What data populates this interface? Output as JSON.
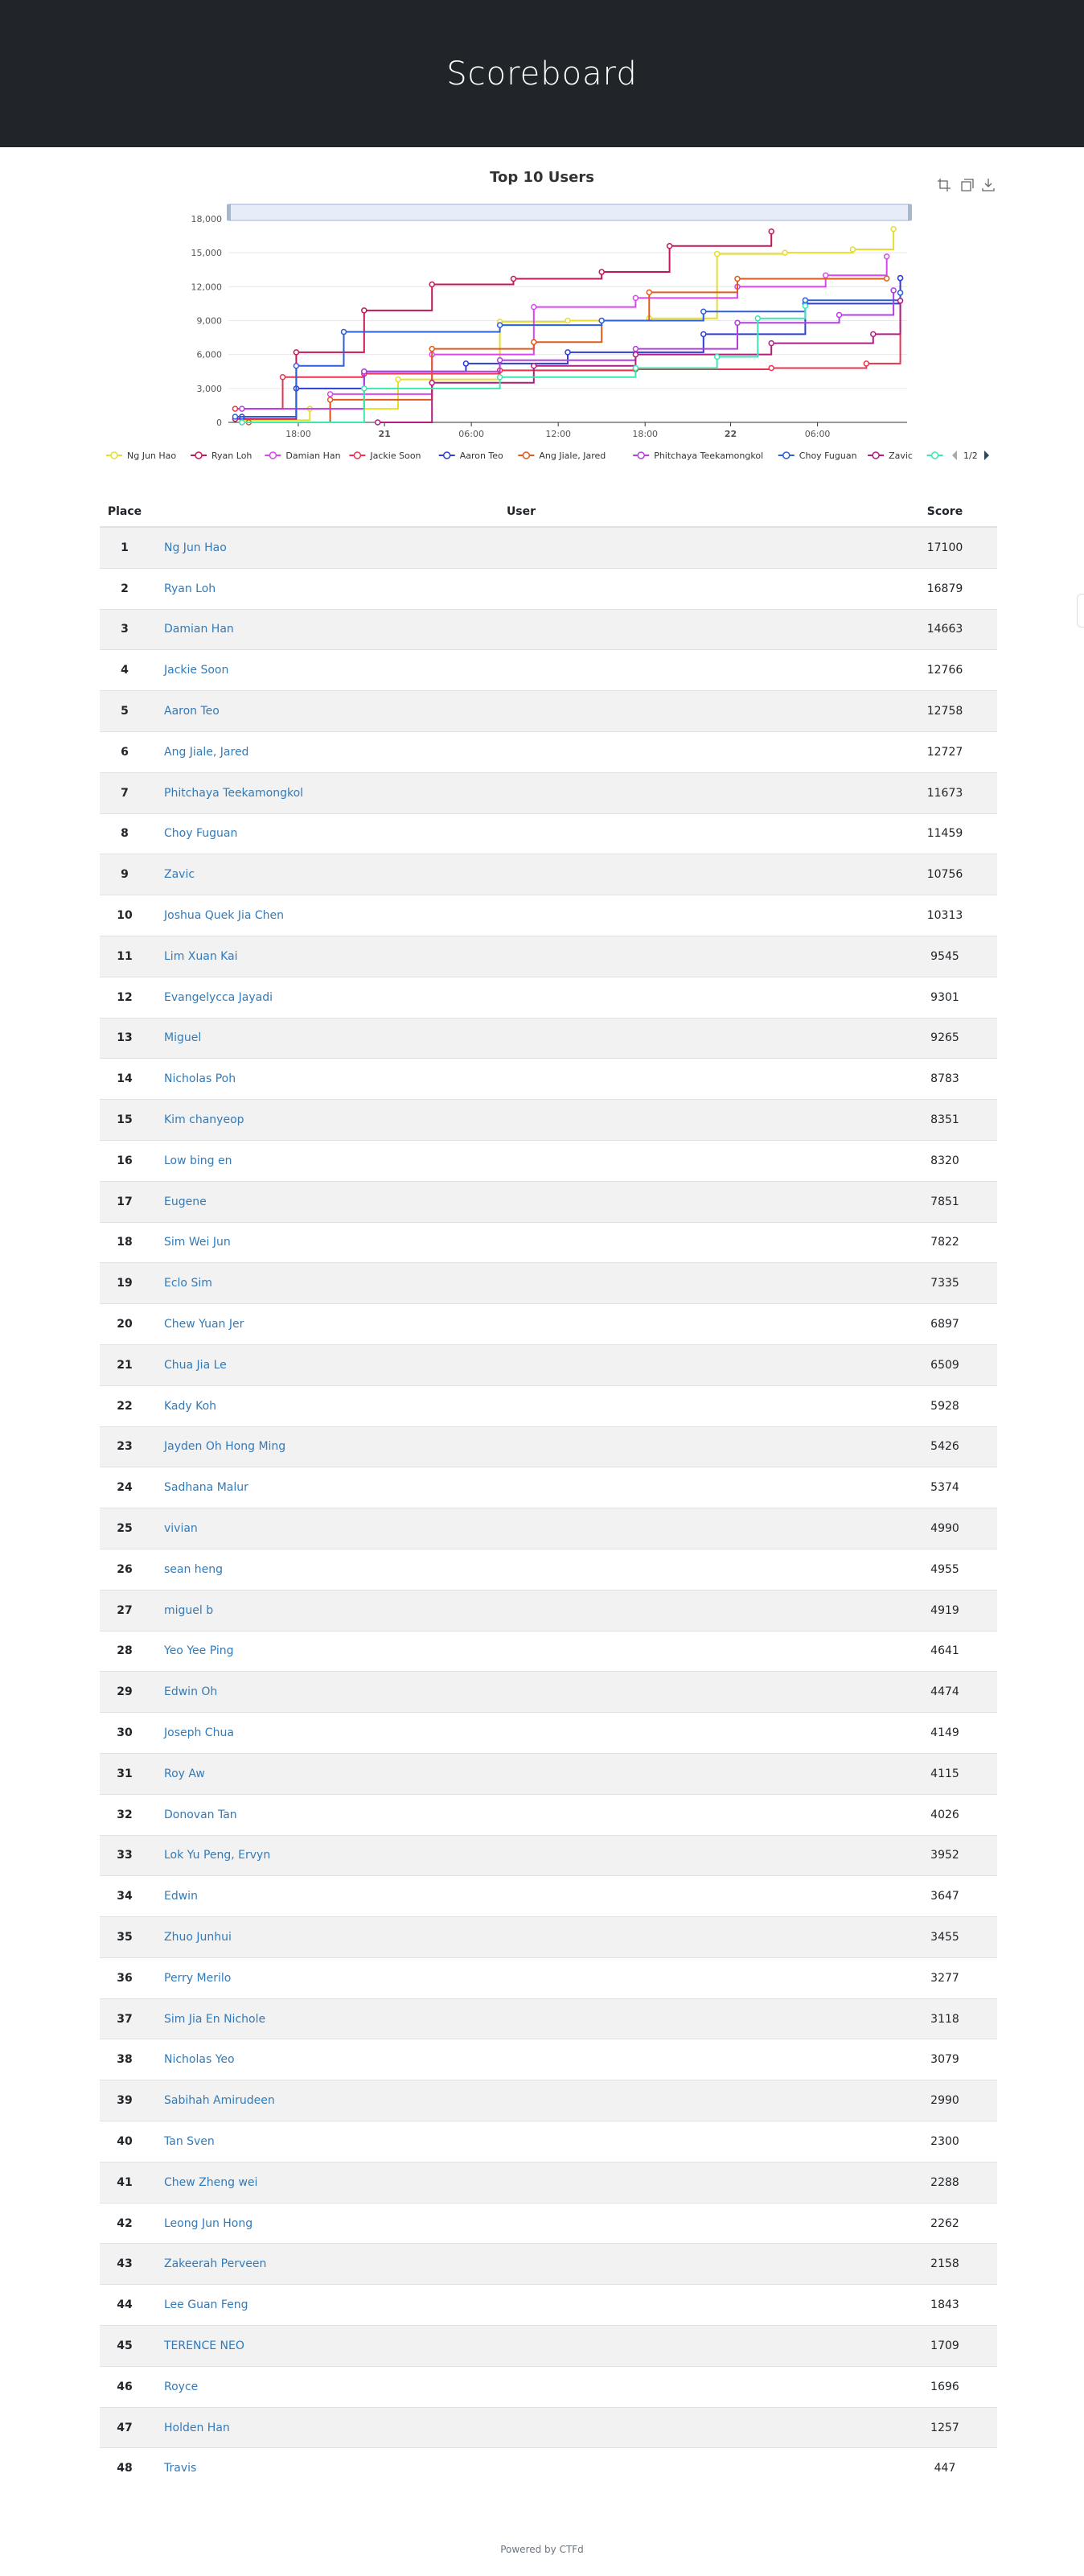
{
  "page": {
    "title": "Scoreboard"
  },
  "chart": {
    "title": "Top 10 Users",
    "y_ticks": [
      "0",
      "3,000",
      "6,000",
      "9,000",
      "12,000",
      "15,000",
      "18,000"
    ],
    "x_ticks": [
      "18:00",
      "21",
      "06:00",
      "12:00",
      "18:00",
      "22",
      "06:00"
    ],
    "legend": [
      {
        "name": "Ng Jun Hao",
        "color": "#e6dd2f"
      },
      {
        "name": "Ryan Loh",
        "color": "#c2185b"
      },
      {
        "name": "Damian Han",
        "color": "#d946ef"
      },
      {
        "name": "Jackie Soon",
        "color": "#e8344e"
      },
      {
        "name": "Aaron Teo",
        "color": "#2c3fd6"
      },
      {
        "name": "Ang Jiale, Jared",
        "color": "#e05a1b"
      },
      {
        "name": "Phitchaya Teekamongkol",
        "color": "#b43fe0"
      },
      {
        "name": "Choy Fuguan",
        "color": "#2f5fd6"
      },
      {
        "name": "Zavic",
        "color": "#b01e80"
      },
      {
        "name": "",
        "color": "#3ee6b0"
      }
    ],
    "legend_page": "1/2",
    "toolbox_icons": [
      "zoom-icon",
      "zoom-reset-icon",
      "download-icon"
    ]
  },
  "chart_data": {
    "type": "line",
    "title": "Top 10 Users",
    "ylim": [
      0,
      18000
    ],
    "x_axis": "time",
    "x_ticks": [
      "18:00",
      "21",
      "06:00",
      "12:00",
      "18:00",
      "22",
      "06:00"
    ],
    "series": [
      {
        "name": "Ng Jun Hao",
        "x": [
          0.02,
          0.12,
          0.25,
          0.4,
          0.5,
          0.62,
          0.72,
          0.82,
          0.92,
          0.98
        ],
        "values": [
          200,
          1200,
          3800,
          8900,
          9000,
          9200,
          14900,
          15000,
          15300,
          17100
        ]
      },
      {
        "name": "Ryan Loh",
        "x": [
          0.01,
          0.1,
          0.2,
          0.3,
          0.42,
          0.55,
          0.65,
          0.8
        ],
        "values": [
          300,
          6200,
          9900,
          12200,
          12700,
          13300,
          15600,
          16879
        ]
      },
      {
        "name": "Damian Han",
        "x": [
          0.02,
          0.15,
          0.3,
          0.45,
          0.6,
          0.75,
          0.88,
          0.97
        ],
        "values": [
          0,
          2500,
          6000,
          10200,
          11000,
          12000,
          13000,
          14663
        ]
      },
      {
        "name": "Jackie Soon",
        "x": [
          0.01,
          0.08,
          0.2,
          0.4,
          0.6,
          0.8,
          0.94,
          0.99
        ],
        "values": [
          1200,
          4000,
          4300,
          4600,
          4700,
          4800,
          5200,
          12766
        ]
      },
      {
        "name": "Aaron Teo",
        "x": [
          0.02,
          0.1,
          0.2,
          0.35,
          0.5,
          0.7,
          0.85,
          0.99
        ],
        "values": [
          500,
          3000,
          4500,
          5200,
          6200,
          7800,
          10500,
          12758
        ]
      },
      {
        "name": "Ang Jiale, Jared",
        "x": [
          0.03,
          0.15,
          0.3,
          0.45,
          0.55,
          0.62,
          0.75,
          0.97
        ],
        "values": [
          0,
          2000,
          6500,
          7100,
          9000,
          11500,
          12700,
          12727
        ]
      },
      {
        "name": "Phitchaya Teekamongkol",
        "x": [
          0.02,
          0.2,
          0.4,
          0.6,
          0.75,
          0.9,
          0.98
        ],
        "values": [
          1200,
          4500,
          5500,
          6500,
          8800,
          9500,
          11673
        ]
      },
      {
        "name": "Choy Fuguan",
        "x": [
          0.01,
          0.1,
          0.17,
          0.4,
          0.55,
          0.7,
          0.85,
          0.99
        ],
        "values": [
          500,
          5000,
          8000,
          8600,
          9000,
          9800,
          10800,
          11459
        ]
      },
      {
        "name": "Zavic",
        "x": [
          0.22,
          0.3,
          0.45,
          0.6,
          0.8,
          0.95,
          0.99
        ],
        "values": [
          0,
          3500,
          5000,
          6000,
          7000,
          7800,
          10756
        ]
      },
      {
        "name": "",
        "x": [
          0.02,
          0.2,
          0.4,
          0.6,
          0.72,
          0.78,
          0.85
        ],
        "values": [
          0,
          3000,
          4000,
          4800,
          5800,
          9200,
          10300
        ]
      }
    ]
  },
  "table": {
    "headers": {
      "place": "Place",
      "user": "User",
      "score": "Score"
    },
    "rows": [
      {
        "place": "1",
        "user": "Ng Jun Hao",
        "score": "17100"
      },
      {
        "place": "2",
        "user": "Ryan Loh",
        "score": "16879"
      },
      {
        "place": "3",
        "user": "Damian Han",
        "score": "14663"
      },
      {
        "place": "4",
        "user": "Jackie Soon",
        "score": "12766"
      },
      {
        "place": "5",
        "user": "Aaron Teo",
        "score": "12758"
      },
      {
        "place": "6",
        "user": "Ang Jiale, Jared",
        "score": "12727"
      },
      {
        "place": "7",
        "user": "Phitchaya Teekamongkol",
        "score": "11673"
      },
      {
        "place": "8",
        "user": "Choy Fuguan",
        "score": "11459"
      },
      {
        "place": "9",
        "user": "Zavic",
        "score": "10756"
      },
      {
        "place": "10",
        "user": "Joshua Quek Jia Chen",
        "score": "10313"
      },
      {
        "place": "11",
        "user": "Lim Xuan Kai",
        "score": "9545"
      },
      {
        "place": "12",
        "user": "Evangelycca Jayadi",
        "score": "9301"
      },
      {
        "place": "13",
        "user": "Miguel",
        "score": "9265"
      },
      {
        "place": "14",
        "user": "Nicholas Poh",
        "score": "8783"
      },
      {
        "place": "15",
        "user": "Kim chanyeop",
        "score": "8351"
      },
      {
        "place": "16",
        "user": "Low bing en",
        "score": "8320"
      },
      {
        "place": "17",
        "user": "Eugene",
        "score": "7851"
      },
      {
        "place": "18",
        "user": "Sim Wei Jun",
        "score": "7822"
      },
      {
        "place": "19",
        "user": "Eclo Sim",
        "score": "7335"
      },
      {
        "place": "20",
        "user": "Chew Yuan Jer",
        "score": "6897"
      },
      {
        "place": "21",
        "user": "Chua Jia Le",
        "score": "6509"
      },
      {
        "place": "22",
        "user": "Kady Koh",
        "score": "5928"
      },
      {
        "place": "23",
        "user": "Jayden Oh Hong Ming",
        "score": "5426"
      },
      {
        "place": "24",
        "user": "Sadhana Malur",
        "score": "5374"
      },
      {
        "place": "25",
        "user": "vivian",
        "score": "4990"
      },
      {
        "place": "26",
        "user": "sean heng",
        "score": "4955"
      },
      {
        "place": "27",
        "user": "miguel b",
        "score": "4919"
      },
      {
        "place": "28",
        "user": "Yeo Yee Ping",
        "score": "4641"
      },
      {
        "place": "29",
        "user": "Edwin Oh",
        "score": "4474"
      },
      {
        "place": "30",
        "user": "Joseph Chua",
        "score": "4149"
      },
      {
        "place": "31",
        "user": "Roy Aw",
        "score": "4115"
      },
      {
        "place": "32",
        "user": "Donovan Tan",
        "score": "4026"
      },
      {
        "place": "33",
        "user": "Lok Yu Peng, Ervyn",
        "score": "3952"
      },
      {
        "place": "34",
        "user": "Edwin",
        "score": "3647"
      },
      {
        "place": "35",
        "user": "Zhuo Junhui",
        "score": "3455"
      },
      {
        "place": "36",
        "user": "Perry Merilo",
        "score": "3277"
      },
      {
        "place": "37",
        "user": "Sim Jia En Nichole",
        "score": "3118"
      },
      {
        "place": "38",
        "user": "Nicholas Yeo",
        "score": "3079"
      },
      {
        "place": "39",
        "user": "Sabihah Amirudeen",
        "score": "2990"
      },
      {
        "place": "40",
        "user": "Tan Sven",
        "score": "2300"
      },
      {
        "place": "41",
        "user": "Chew Zheng wei",
        "score": "2288"
      },
      {
        "place": "42",
        "user": "Leong Jun Hong",
        "score": "2262"
      },
      {
        "place": "43",
        "user": "Zakeerah Perveen",
        "score": "2158"
      },
      {
        "place": "44",
        "user": "Lee Guan Feng",
        "score": "1843"
      },
      {
        "place": "45",
        "user": "TERENCE NEO",
        "score": "1709"
      },
      {
        "place": "46",
        "user": "Royce",
        "score": "1696"
      },
      {
        "place": "47",
        "user": "Holden Han",
        "score": "1257"
      },
      {
        "place": "48",
        "user": "Travis",
        "score": "447"
      }
    ]
  },
  "footer": {
    "text": "Powered by CTFd"
  }
}
